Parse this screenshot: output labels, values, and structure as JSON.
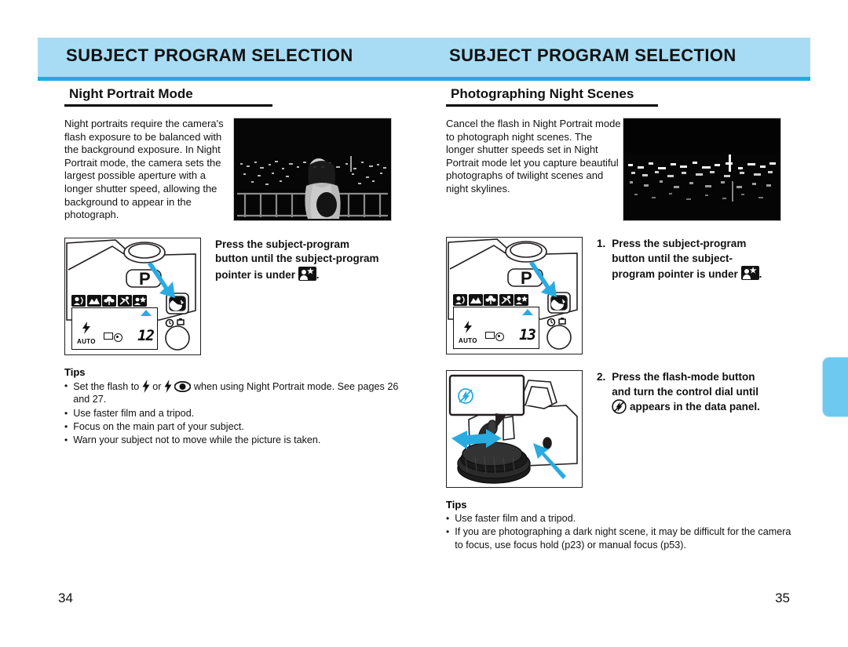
{
  "document": {
    "header_title_left": "SUBJECT PROGRAM SELECTION",
    "header_title_right": "SUBJECT PROGRAM SELECTION",
    "page_number_left": "34",
    "page_number_right": "35"
  },
  "colors": {
    "header_band": "#a8dcf4",
    "header_rule": "#27a8dd",
    "accent_arrow": "#29abe2",
    "side_tab": "#6ec9f0"
  },
  "left_page": {
    "section_heading": "Night Portrait Mode",
    "intro_paragraph": "Night portraits require the camera's flash exposure to be balanced with the background exposure. In Night Portrait mode, the camera sets the largest possible aperture with a longer shutter speed, allowing the background to appear in the photograph.",
    "photo_caption": "night-portrait-photo",
    "figure": {
      "name": "camera-top-subject-program-figure",
      "mode_letter": "P",
      "lcd_frame_count": "12",
      "lcd_flash_label": "AUTO",
      "lcd_icons": [
        "portrait-icon",
        "landscape-icon",
        "macro-icon",
        "sports-icon",
        "night-portrait-icon"
      ],
      "pointer_under": "night-portrait-icon"
    },
    "instruction": {
      "line1": "Press the subject-program",
      "line2": "button until the subject-program",
      "line3_before": "pointer is under",
      "line3_icon": "night-portrait-icon",
      "line3_after": "."
    },
    "tips_title": "Tips",
    "tips": [
      {
        "before": "Set the flash to",
        "icon1": "flash-fill-icon",
        "middle": "or",
        "icon2": "flash-fill-icon",
        "icon3": "red-eye-icon",
        "after": "when using Night Portrait mode. See pages 26 and 27."
      },
      {
        "text": "Use faster film and a tripod."
      },
      {
        "text": "Focus on the main part of your subject."
      },
      {
        "text": "Warn your subject not to move while the picture is taken."
      }
    ]
  },
  "right_page": {
    "section_heading": "Photographing Night Scenes",
    "intro_paragraph": "Cancel the flash in Night Portrait mode to photograph night scenes. The longer shutter speeds set in Night Portrait mode let you capture beautiful photographs of twilight scenes and night skylines.",
    "photo_caption": "night-cityscape-photo",
    "step1": {
      "number": "1.",
      "line1": "Press the subject-program",
      "line2": "button until the subject-",
      "line3_before": "program pointer is under",
      "line3_icon": "night-portrait-icon",
      "line3_after": "."
    },
    "figure1": {
      "name": "camera-top-subject-program-figure",
      "mode_letter": "P",
      "lcd_frame_count": "13",
      "lcd_flash_label": "AUTO",
      "lcd_icons": [
        "portrait-icon",
        "landscape-icon",
        "macro-icon",
        "sports-icon",
        "night-portrait-icon"
      ],
      "pointer_under": "night-portrait-icon"
    },
    "step2": {
      "number": "2.",
      "line1": "Press the flash-mode button",
      "line2": "and turn the control dial until",
      "line3_icon": "flash-cancel-icon",
      "line3_after": "appears in the data panel."
    },
    "figure2": {
      "name": "camera-flash-mode-dial-figure",
      "callout_icon": "flash-cancel-icon"
    },
    "tips_title": "Tips",
    "tips": [
      {
        "text": "Use faster film and a tripod."
      },
      {
        "text": "If you are photographing a dark night scene, it may be difficult for the camera to focus, use focus hold (p23) or manual focus (p53)."
      }
    ]
  }
}
